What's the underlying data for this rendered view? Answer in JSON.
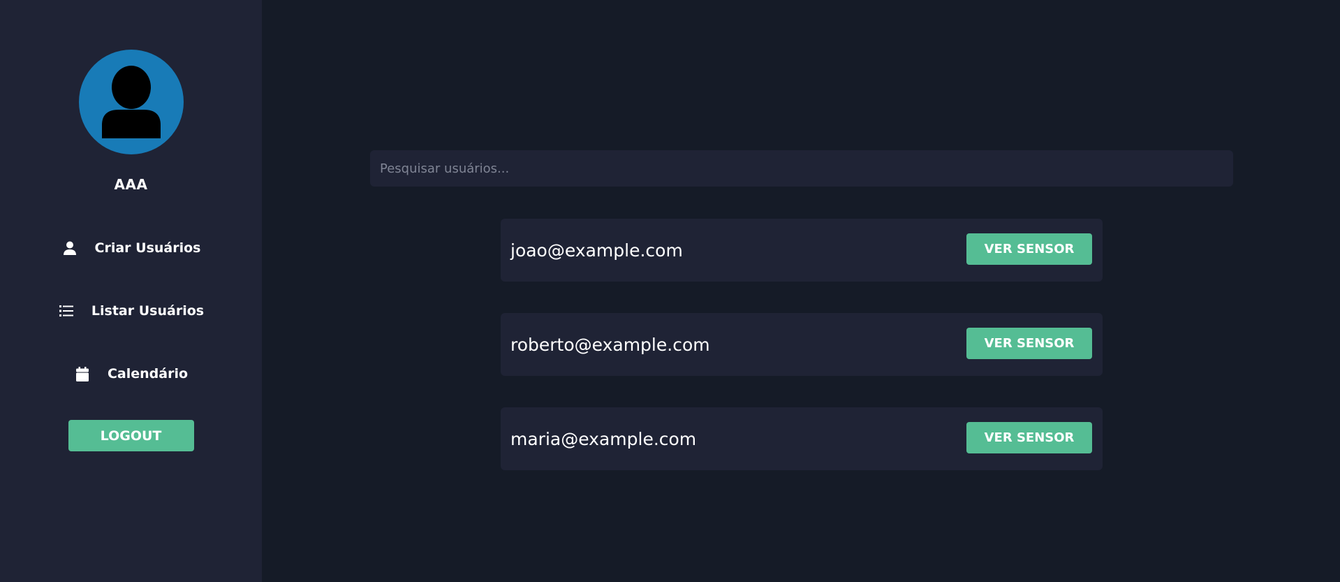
{
  "profile": {
    "name": "AAA",
    "avatar_icon": "user-avatar-icon",
    "avatar_color": "#187bb7"
  },
  "nav": {
    "items": [
      {
        "label": "Criar Usuários",
        "icon": "user-icon"
      },
      {
        "label": "Listar Usuários",
        "icon": "list-icon"
      },
      {
        "label": "Calendário",
        "icon": "calendar-icon"
      }
    ],
    "logout_label": "LOGOUT"
  },
  "search": {
    "placeholder": "Pesquisar usuários...",
    "value": ""
  },
  "users": [
    {
      "email": "joao@example.com",
      "action_label": "VER SENSOR"
    },
    {
      "email": "roberto@example.com",
      "action_label": "VER SENSOR"
    },
    {
      "email": "maria@example.com",
      "action_label": "VER SENSOR"
    }
  ],
  "colors": {
    "accent": "#55bd94",
    "sidebar_bg": "#1f2335",
    "main_bg": "#151b27",
    "card_bg": "#1f2335"
  }
}
